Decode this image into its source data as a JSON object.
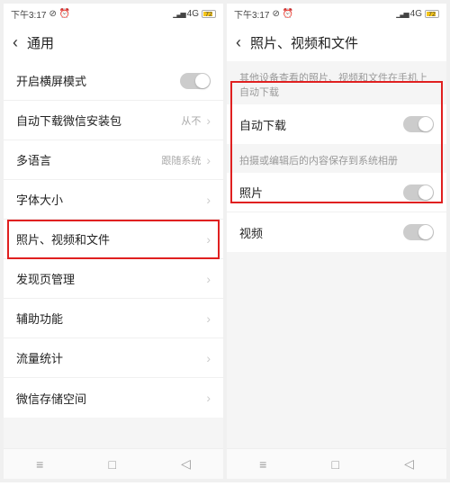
{
  "statusbar": {
    "time": "下午3:17",
    "network": "4G",
    "battery": "72"
  },
  "left": {
    "title": "通用",
    "rows": [
      {
        "label": "开启横屏模式",
        "type": "toggle",
        "state": "off"
      },
      {
        "label": "自动下载微信安装包",
        "type": "value",
        "value": "从不"
      },
      {
        "label": "多语言",
        "type": "value",
        "value": "跟随系统"
      },
      {
        "label": "字体大小",
        "type": "link"
      },
      {
        "label": "照片、视频和文件",
        "type": "link"
      },
      {
        "label": "发现页管理",
        "type": "link"
      },
      {
        "label": "辅助功能",
        "type": "link"
      },
      {
        "label": "流量统计",
        "type": "link"
      },
      {
        "label": "微信存储空间",
        "type": "link"
      }
    ]
  },
  "right": {
    "title": "照片、视频和文件",
    "desc1": "其他设备查看的照片、视频和文件在手机上自动下载",
    "desc2": "拍摄或编辑后的内容保存到系统相册",
    "rows1": [
      {
        "label": "自动下载",
        "type": "toggle",
        "state": "off"
      }
    ],
    "rows2": [
      {
        "label": "照片",
        "type": "toggle",
        "state": "off"
      },
      {
        "label": "视频",
        "type": "toggle",
        "state": "off"
      }
    ]
  }
}
